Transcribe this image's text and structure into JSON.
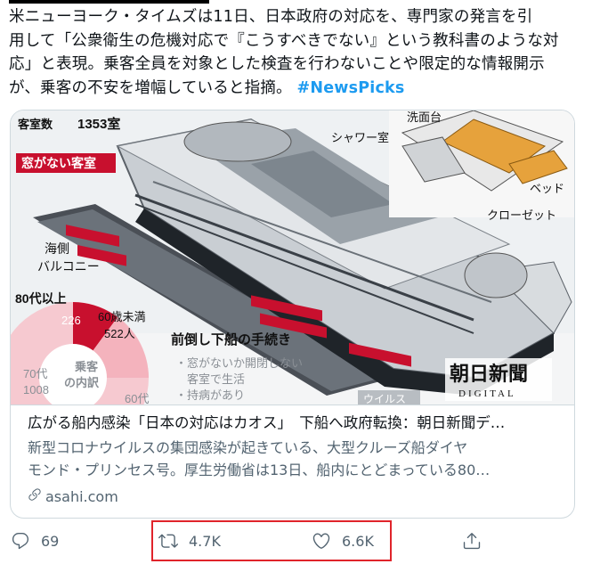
{
  "tweet": {
    "text_line1": "米ニューヨーク・タイムズは11日、日本政府の対応を、専門家の発言を引",
    "text_line2": "用して「公衆衛生の危機対応で『こうすべきでない』という教科書のような対",
    "text_line3": "応」と表現。乗客全員を対象とした検査を行わないことや限定的な情報開示",
    "text_line4": "が、乗客の不安を増幅していると指摘。",
    "hashtag": "#NewsPicks"
  },
  "card": {
    "image": {
      "rooms_label": "客室数",
      "rooms_count": "1353室",
      "windowless_label": "窓がない客室",
      "balcony_label_1": "海側",
      "balcony_label_2": "バルコニー",
      "washbasin_label": "洗面台",
      "shower_label": "シャワー室",
      "bed_label": "ベッド",
      "closet_label": "クローゼット",
      "age80_label": "80代以上",
      "age80_value": "226",
      "under60_label": "60歳未満",
      "under60_value": "522人",
      "pie_center_1": "乗客",
      "pie_center_2": "の内訳",
      "age70_label": "70代",
      "age70_value": "1008",
      "age60_label": "60代",
      "procedure_title": "前倒し下船の手続き",
      "procedure_item_1": "・窓がないか開閉しない",
      "procedure_item_2": "客室で生活",
      "procedure_item_3": "・持病があり",
      "virus_label": "ウイルス",
      "logo_text": "朝日新聞",
      "logo_sub": "DIGITAL"
    },
    "title": "広がる船内感染「日本の対応はカオス」　下船へ政府転換：朝日新聞デ…",
    "desc_line1": "新型コロナウイルスの集団感染が起きている、大型クルーズ船ダイヤ",
    "desc_line2": "モンド・プリンセス号。厚生労働省は13日、船内にとどまっている80…",
    "domain": "asahi.com"
  },
  "actions": {
    "reply_count": "69",
    "retweet_count": "4.7K",
    "like_count": "6.6K"
  },
  "icons": [
    "link-icon",
    "reply-icon",
    "retweet-icon",
    "like-icon",
    "share-icon"
  ],
  "colors": {
    "hashtag": "#1d9bf0",
    "secondary_text": "#536471",
    "card_border": "#cfd9de",
    "highlight": "#e0242b",
    "cabin_red": "#c8102e"
  }
}
